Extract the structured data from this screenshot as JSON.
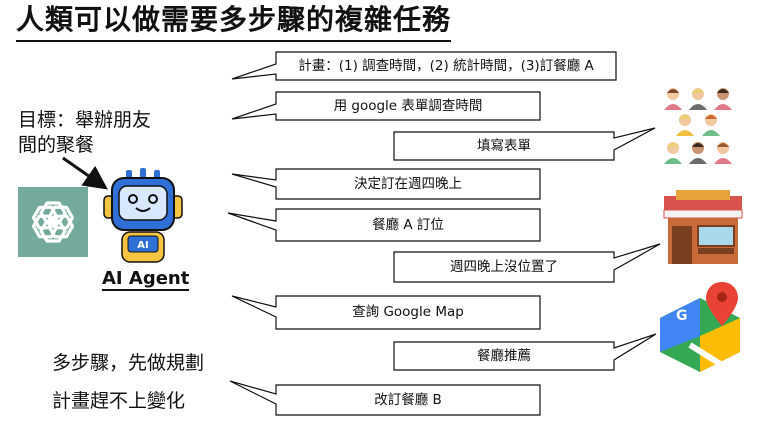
{
  "title": "人類可以做需要多步驟的複雜任務",
  "goal": {
    "line1": "目標：舉辦朋友",
    "line2": "間的聚餐"
  },
  "agent_label": "AI Agent",
  "robot_face_label": "AI",
  "notes": {
    "multi_step": "多步驟，先做規劃",
    "plan_change": "計畫趕不上變化"
  },
  "bubbles": [
    {
      "id": "plan",
      "text": "計畫：(1) 調查時間，(2) 統計時間，(3)訂餐廳 A"
    },
    {
      "id": "google-form",
      "text": "用 google 表單調查時間"
    },
    {
      "id": "fill-form",
      "text": "填寫表單"
    },
    {
      "id": "decide",
      "text": "決定訂在週四晚上"
    },
    {
      "id": "book-a",
      "text": "餐廳 A 訂位"
    },
    {
      "id": "no-seat",
      "text": "週四晚上沒位置了"
    },
    {
      "id": "google-map",
      "text": "查詢 Google Map"
    },
    {
      "id": "recommend",
      "text": "餐廳推薦"
    },
    {
      "id": "book-b",
      "text": "改訂餐廳 B"
    }
  ],
  "icons": {
    "chatgpt": "openai-logo-icon",
    "robot": "robot-icon",
    "people": "people-group-icon",
    "restaurant": "restaurant-icon",
    "map": "google-maps-icon"
  },
  "colors": {
    "chatgpt_bg": "#74aa9c",
    "robot_blue": "#2f6fd6",
    "map_green": "#34a853",
    "map_red": "#ea4335"
  }
}
